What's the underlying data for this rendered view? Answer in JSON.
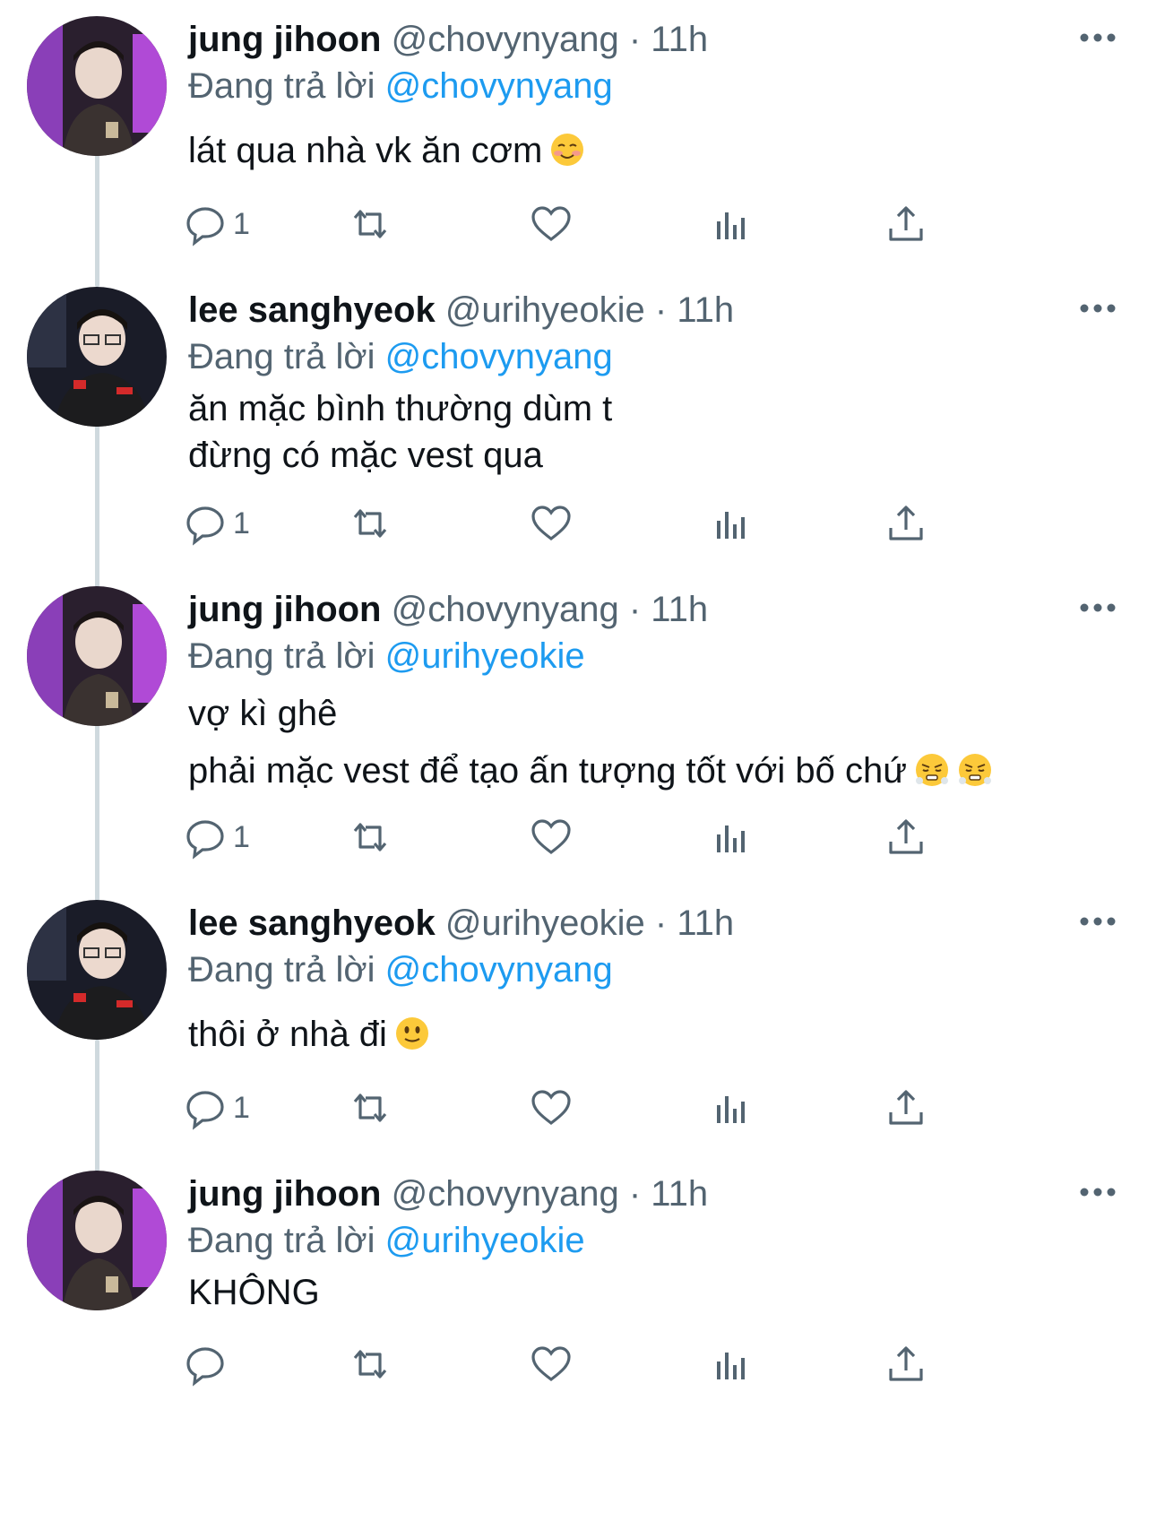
{
  "colors": {
    "accent": "#1d9bf0",
    "muted": "#536471",
    "line": "#cfd9de"
  },
  "tweets": [
    {
      "name": "jung jihoon",
      "handle": "@chovynyang",
      "dot": "·",
      "time": "11h",
      "replying_label": "Đang trả lời",
      "replying_to": "@chovynyang",
      "lines": [
        "lát qua nhà vk ăn cơm"
      ],
      "emoji": "smiling-blush-emoji",
      "reply_count": "1"
    },
    {
      "name": "lee sanghyeok",
      "handle": "@urihyeokie",
      "dot": "·",
      "time": "11h",
      "replying_label": "Đang trả lời",
      "replying_to": "@chovynyang",
      "lines": [
        "ăn mặc bình thường dùm t",
        "đừng có mặc vest qua"
      ],
      "reply_count": "1"
    },
    {
      "name": "jung jihoon",
      "handle": "@chovynyang",
      "dot": "·",
      "time": "11h",
      "replying_label": "Đang trả lời",
      "replying_to": "@urihyeokie",
      "lines": [
        "vợ kì ghê",
        "phải mặc vest để tạo ấn tượng tốt với bố chứ"
      ],
      "emoji": "huffing-face-emoji",
      "reply_count": "1"
    },
    {
      "name": "lee sanghyeok",
      "handle": "@urihyeokie",
      "dot": "·",
      "time": "11h",
      "replying_label": "Đang trả lời",
      "replying_to": "@chovynyang",
      "lines": [
        "thôi ở nhà đi"
      ],
      "emoji": "slight-smile-emoji",
      "reply_count": "1"
    },
    {
      "name": "jung jihoon",
      "handle": "@chovynyang",
      "dot": "·",
      "time": "11h",
      "replying_label": "Đang trả lời",
      "replying_to": "@urihyeokie",
      "lines": [
        "KHÔNG"
      ],
      "reply_count": ""
    }
  ],
  "icons": {
    "reply": "reply-icon",
    "retweet": "retweet-icon",
    "like": "heart-icon",
    "views": "views-chart-icon",
    "share": "share-icon",
    "more": "more-dots-icon"
  }
}
